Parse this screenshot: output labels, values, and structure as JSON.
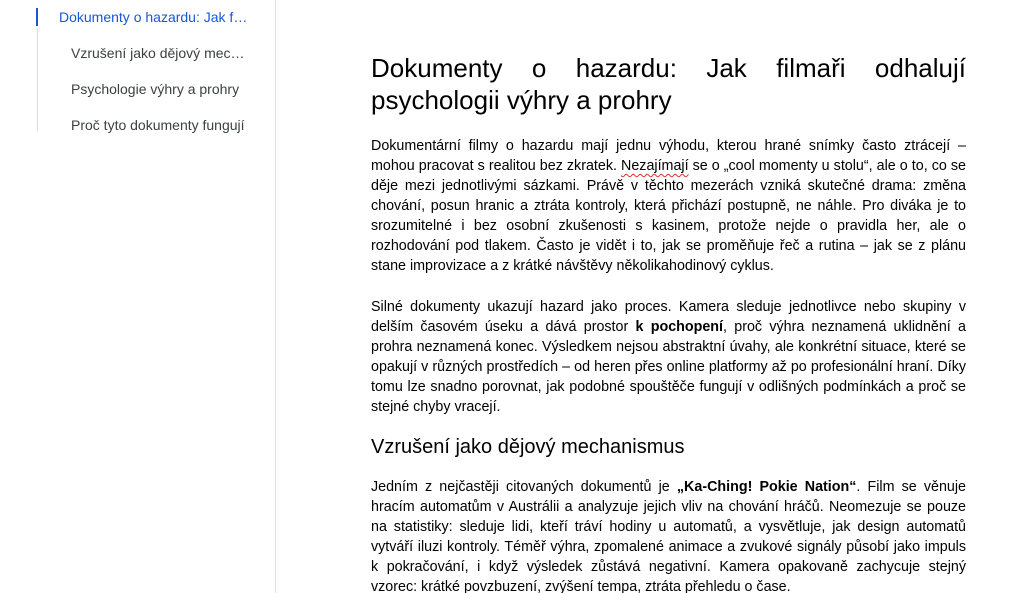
{
  "outline": {
    "items": [
      {
        "label": "Dokumenty o hazardu: Jak filmaři odhalují psychologii výhry a prohry",
        "level": 1,
        "active": true
      },
      {
        "label": "Vzrušení jako dějový mechanismus",
        "level": 2,
        "active": false
      },
      {
        "label": "Psychologie výhry a prohry",
        "level": 2,
        "active": false
      },
      {
        "label": "Proč tyto dokumenty fungují",
        "level": 2,
        "active": false
      }
    ]
  },
  "doc": {
    "title": "Dokumenty o hazardu: Jak filmaři odhalují psychologii výhry a prohry",
    "p1": {
      "a": "Dokumentární filmy o hazardu mají jednu výhodu, kterou hrané snímky často ztrácejí – mohou pracovat s realitou bez zkratek. ",
      "misspelled": "Nezajímají",
      "b": " se o „cool momenty u stolu“, ale o to, co se děje mezi jednotlivými sázkami. Právě v těchto mezerách vzniká skutečné drama: změna chování, posun hranic a ztráta kontroly, která přichází postupně, ne náhle. Pro diváka je to srozumitelné i bez osobní zkušenosti s kasinem, protože nejde o pravidla her, ale o rozhodování pod tlakem. Často je vidět i to, jak se proměňuje řeč a rutina – jak se z plánu stane improvizace a z krátké návštěvy několikahodinový cyklus."
    },
    "p2": {
      "a": "Silné dokumenty ukazují hazard jako proces. Kamera sleduje jednotlivce nebo skupiny v delším časovém úseku a dává prostor ",
      "bold": "k pochopení",
      "b": ", proč výhra neznamená uklidnění a prohra neznamená konec. Výsledkem nejsou abstraktní úvahy, ale konkrétní situace, které se opakují v různých prostředích – od heren přes online platformy až po profesionální hraní. Díky tomu lze snadno porovnat, jak podobné spouštěče fungují v odlišných podmínkách a proč se stejné chyby vracejí."
    },
    "h2": "Vzrušení jako dějový mechanismus",
    "p3": {
      "a": "Jedním z nejčastěji citovaných dokumentů je ",
      "bold": "„Ka-Ching! Pokie Nation“",
      "b": ". Film se věnuje hracím automatům v Austrálii a analyzuje jejich vliv na chování hráčů. Neomezuje se pouze na statistiky: sleduje lidi, kteří tráví hodiny u automatů, a vysvětluje, jak design automatů vytváří iluzi kontroly. Téměř výhra, zpomalené animace a zvukové signály působí jako impuls k pokračování, i když výsledek zůstává negativní. Kamera opakovaně zachycuje stejný vzorec: krátké povzbuzení, zvýšení tempa, ztráta přehledu o čase."
    }
  },
  "colors": {
    "accent": "#1a56d6",
    "text": "#000000",
    "outline_text": "#3c4043",
    "spellcheck": "#d93025"
  }
}
